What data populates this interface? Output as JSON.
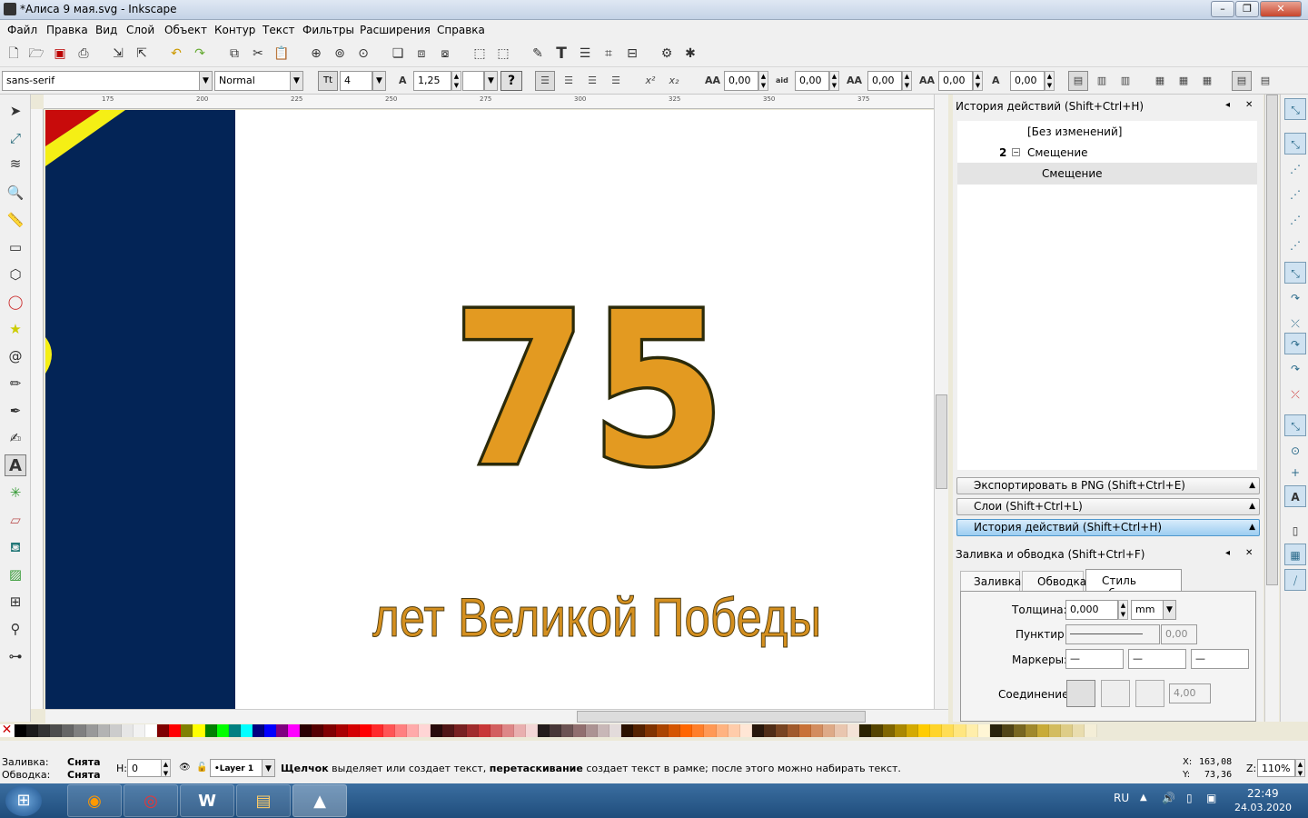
{
  "window": {
    "title": "*Алиса 9 мая.svg - Inkscape"
  },
  "menu": [
    "Файл",
    "Правка",
    "Вид",
    "Слой",
    "Объект",
    "Контур",
    "Текст",
    "Фильтры",
    "Расширения",
    "Справка"
  ],
  "text_toolbar": {
    "font_family": "sans-serif",
    "font_style": "Normal",
    "font_size": "4",
    "line_spacing": "1,25",
    "help_label": "?",
    "letter_spacing": "0,00",
    "word_spacing": "0,00",
    "horiz_kern": "0,00",
    "vert_shift": "0,00",
    "rotation": "0,00"
  },
  "ruler_labels": [
    "175",
    "200",
    "225",
    "250",
    "275",
    "300",
    "325",
    "350",
    "375"
  ],
  "canvas": {
    "big_number": "75",
    "subtitle": "лет Великой Победы",
    "number_fill": "#e39a21",
    "number_stroke": "#2b2a0a",
    "subtitle_fill": "#d48f1f",
    "subtitle_stroke": "#4a3a10",
    "navy": "#032456",
    "red": "#c80b0b",
    "yellow": "#f5ef15"
  },
  "history_panel": {
    "title": "История действий (Shift+Ctrl+H)",
    "items": [
      {
        "num": "",
        "label": "[Без изменений]"
      },
      {
        "num": "2",
        "label": "Смещение"
      },
      {
        "num": "",
        "label": "Смещение"
      }
    ]
  },
  "expanders": [
    {
      "label": "Экспортировать в PNG (Shift+Ctrl+E)"
    },
    {
      "label": "Слои (Shift+Ctrl+L)"
    },
    {
      "label": "История действий (Shift+Ctrl+H)"
    }
  ],
  "fill_stroke": {
    "title": "Заливка и обводка (Shift+Ctrl+F)",
    "tabs": [
      "Заливка",
      "Обводка",
      "Стиль обводки"
    ],
    "width_label": "Толщина:",
    "width_value": "0,000",
    "unit": "mm",
    "dash_label": "Пунктир:",
    "dash_value": "0,00",
    "markers_label": "Маркеры:",
    "join_label": "Соединение:",
    "miter_value": "4,00"
  },
  "status": {
    "fill_label": "Заливка:",
    "fill_value": "Снята",
    "stroke_label": "Обводка:",
    "stroke_value": "Снята",
    "h_label": "H:",
    "h_value": "0",
    "layer": "•Layer 1",
    "msg_bold1": "Щелчок",
    "msg1": " выделяет или создает текст, ",
    "msg_bold2": "перетаскивание",
    "msg2": " создает текст в рамке; после этого можно набирать текст.",
    "x_label": "X:",
    "x_value": "163,08",
    "y_label": "Y:",
    "y_value": "73,36",
    "z_label": "Z:",
    "zoom": "110%"
  },
  "taskbar": {
    "lang": "RU",
    "time": "22:49",
    "date": "24.03.2020"
  },
  "palette": [
    "#000000",
    "#1a1a1a",
    "#333333",
    "#4d4d4d",
    "#666666",
    "#808080",
    "#999999",
    "#b3b3b3",
    "#cccccc",
    "#e6e6e6",
    "#f2f2f2",
    "#ffffff",
    "#800000",
    "#ff0000",
    "#808000",
    "#ffff00",
    "#008000",
    "#00ff00",
    "#008080",
    "#00ffff",
    "#000080",
    "#0000ff",
    "#800080",
    "#ff00ff",
    "#2b0000",
    "#550000",
    "#800000",
    "#aa0000",
    "#d40000",
    "#ff0000",
    "#ff2a2a",
    "#ff5555",
    "#ff8080",
    "#ffaaaa",
    "#ffd5d5",
    "#280b0b",
    "#501616",
    "#782121",
    "#a02c2c",
    "#c83737",
    "#d35f5f",
    "#de8787",
    "#e9afaf",
    "#f4d7d7",
    "#241c1c",
    "#483737",
    "#6c5353",
    "#916f6f",
    "#ac9393",
    "#c8b7b7",
    "#e3dbdb",
    "#2b1100",
    "#552200",
    "#803300",
    "#aa4400",
    "#d45500",
    "#ff6600",
    "#ff7f2a",
    "#ff9955",
    "#ffb380",
    "#ffccaa",
    "#ffe6d5",
    "#28170b",
    "#502d16",
    "#784421",
    "#a05a2c",
    "#c87137",
    "#d38d5f",
    "#deaa87",
    "#e9c6af",
    "#f4e3d7",
    "#2b2200",
    "#554400",
    "#806600",
    "#aa8800",
    "#d4aa00",
    "#ffcc00",
    "#ffd42a",
    "#ffdd55",
    "#ffe680",
    "#ffeeaa",
    "#fff6d5",
    "#28220b",
    "#504416",
    "#786721",
    "#a0892c",
    "#c8ab37",
    "#d3bc5f",
    "#decd87",
    "#e9ddaf",
    "#f4eed7"
  ]
}
